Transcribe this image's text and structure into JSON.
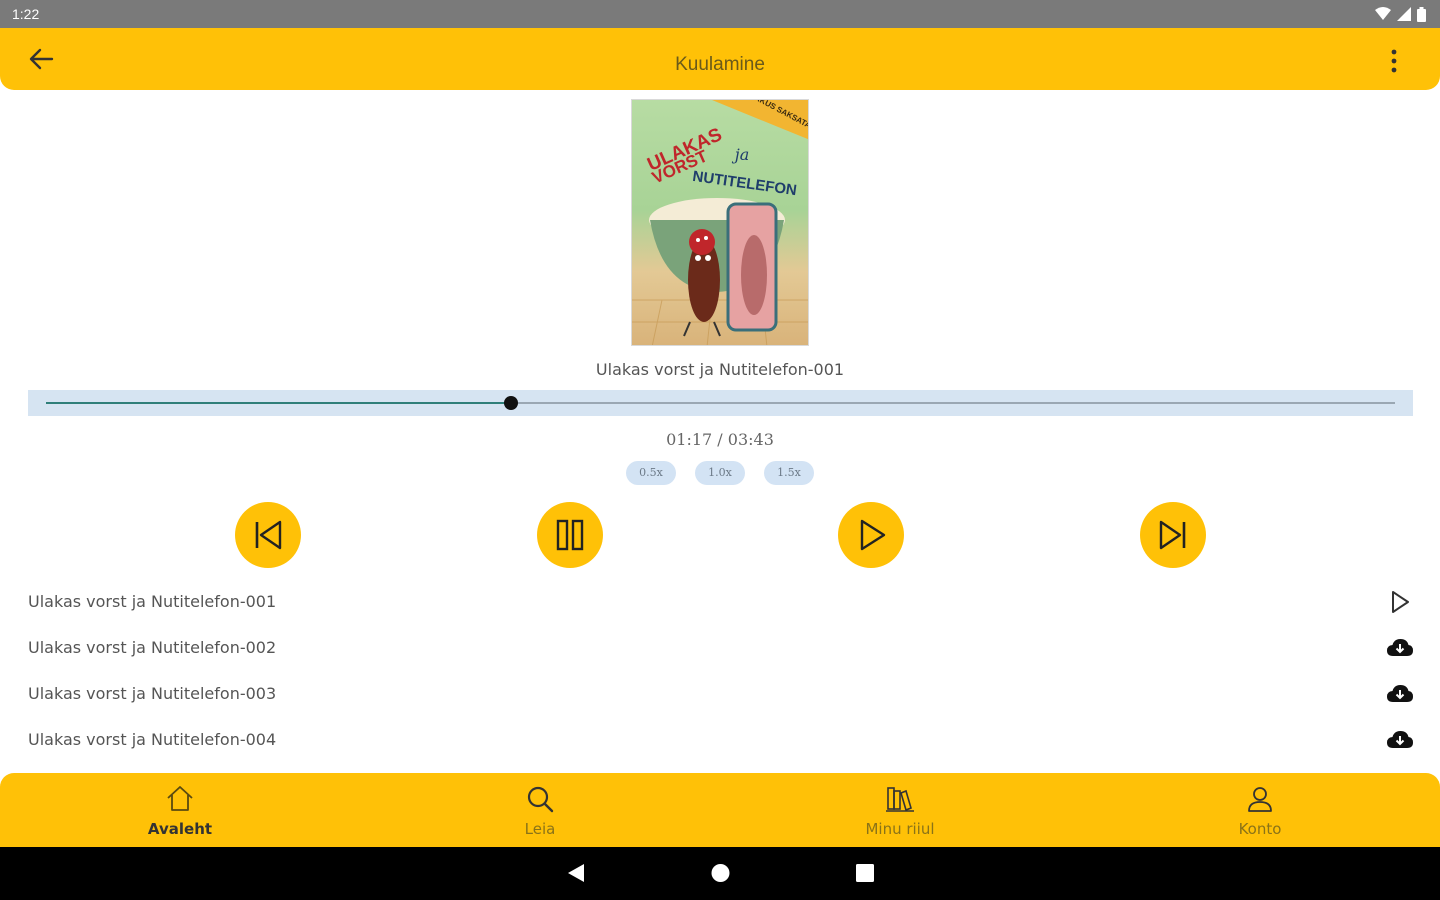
{
  "status_bar": {
    "time": "1:22"
  },
  "app_bar": {
    "title": "Kuulamine"
  },
  "player": {
    "track_title": "Ulakas vorst ja Nutitelefon-001",
    "elapsed": "01:17",
    "duration": "03:43",
    "time_readout": "01:17 / 03:43",
    "progress_fraction": 0.345,
    "speeds": [
      "0.5x",
      "1.0x",
      "1.5x"
    ]
  },
  "cover": {
    "author": "MARKUS SAKSATAMM",
    "title_line1": "ULAKAS",
    "title_line2": "VORST",
    "title_line3": "ja",
    "title_line4": "NUTITELEFON"
  },
  "chapters": [
    {
      "label": "Ulakas vorst ja Nutitelefon-001",
      "action": "play-icon"
    },
    {
      "label": "Ulakas vorst ja Nutitelefon-002",
      "action": "cloud-download-icon"
    },
    {
      "label": "Ulakas vorst ja Nutitelefon-003",
      "action": "cloud-download-icon"
    },
    {
      "label": "Ulakas vorst ja Nutitelefon-004",
      "action": "cloud-download-icon"
    }
  ],
  "bottom_nav": [
    {
      "label": "Avaleht",
      "icon": "home-icon",
      "active": true
    },
    {
      "label": "Leia",
      "icon": "search-icon",
      "active": false
    },
    {
      "label": "Minu riiul",
      "icon": "bookshelf-icon",
      "active": false
    },
    {
      "label": "Konto",
      "icon": "account-icon",
      "active": false
    }
  ],
  "colors": {
    "accent": "#FFC107",
    "seek_track": "#d6e4f2",
    "seek_fill": "#2f7f7a",
    "chip": "#d3e3f4"
  }
}
